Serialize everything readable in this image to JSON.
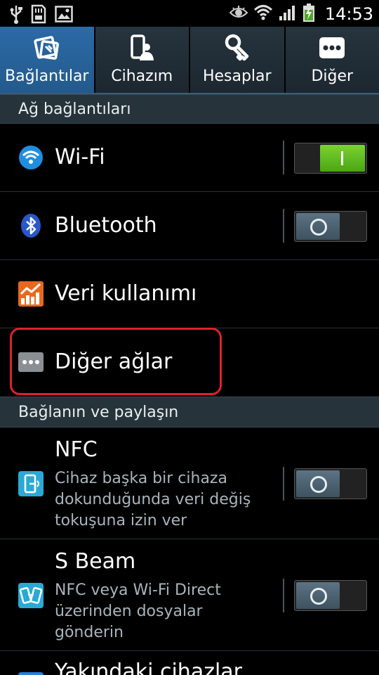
{
  "statusbar": {
    "time": "14:53",
    "icons_left": [
      "usb-icon",
      "sd-card-icon",
      "image-icon"
    ],
    "icons_right": [
      "eye-icon",
      "wifi-icon",
      "signal-icon",
      "battery-charging-icon"
    ]
  },
  "tabs": [
    {
      "label": "Bağlantılar",
      "active": true,
      "icon": "connections-icon"
    },
    {
      "label": "Cihazım",
      "active": false,
      "icon": "my-device-icon"
    },
    {
      "label": "Hesaplar",
      "active": false,
      "icon": "accounts-icon"
    },
    {
      "label": "Diğer",
      "active": false,
      "icon": "more-icon"
    }
  ],
  "sections": {
    "network": "Ağ bağlantıları",
    "connect_share": "Bağlanın ve paylaşın"
  },
  "rows": {
    "wifi": {
      "title": "Wi-Fi",
      "toggle": "on"
    },
    "bluetooth": {
      "title": "Bluetooth",
      "toggle": "off"
    },
    "data_usage": {
      "title": "Veri kullanımı"
    },
    "more_networks": {
      "title": "Diğer ağlar"
    },
    "nfc": {
      "title": "NFC",
      "desc_lines": [
        "Cihaz başka bir cihaza",
        "dokunduğunda veri değiş",
        "tokuşuna izin ver"
      ],
      "toggle": "off"
    },
    "sbeam": {
      "title": "S Beam",
      "desc_lines": [
        "NFC veya Wi-Fi Direct",
        "üzerinden dosyalar",
        "gönderin"
      ],
      "toggle": "off"
    },
    "nearby": {
      "title": "Yakındaki cihazlar"
    }
  },
  "colors": {
    "active_tab": "#2c6aa6",
    "toggle_on": "#5cbd1f",
    "highlight": "#e0202e",
    "section_bg": "#27333b"
  }
}
